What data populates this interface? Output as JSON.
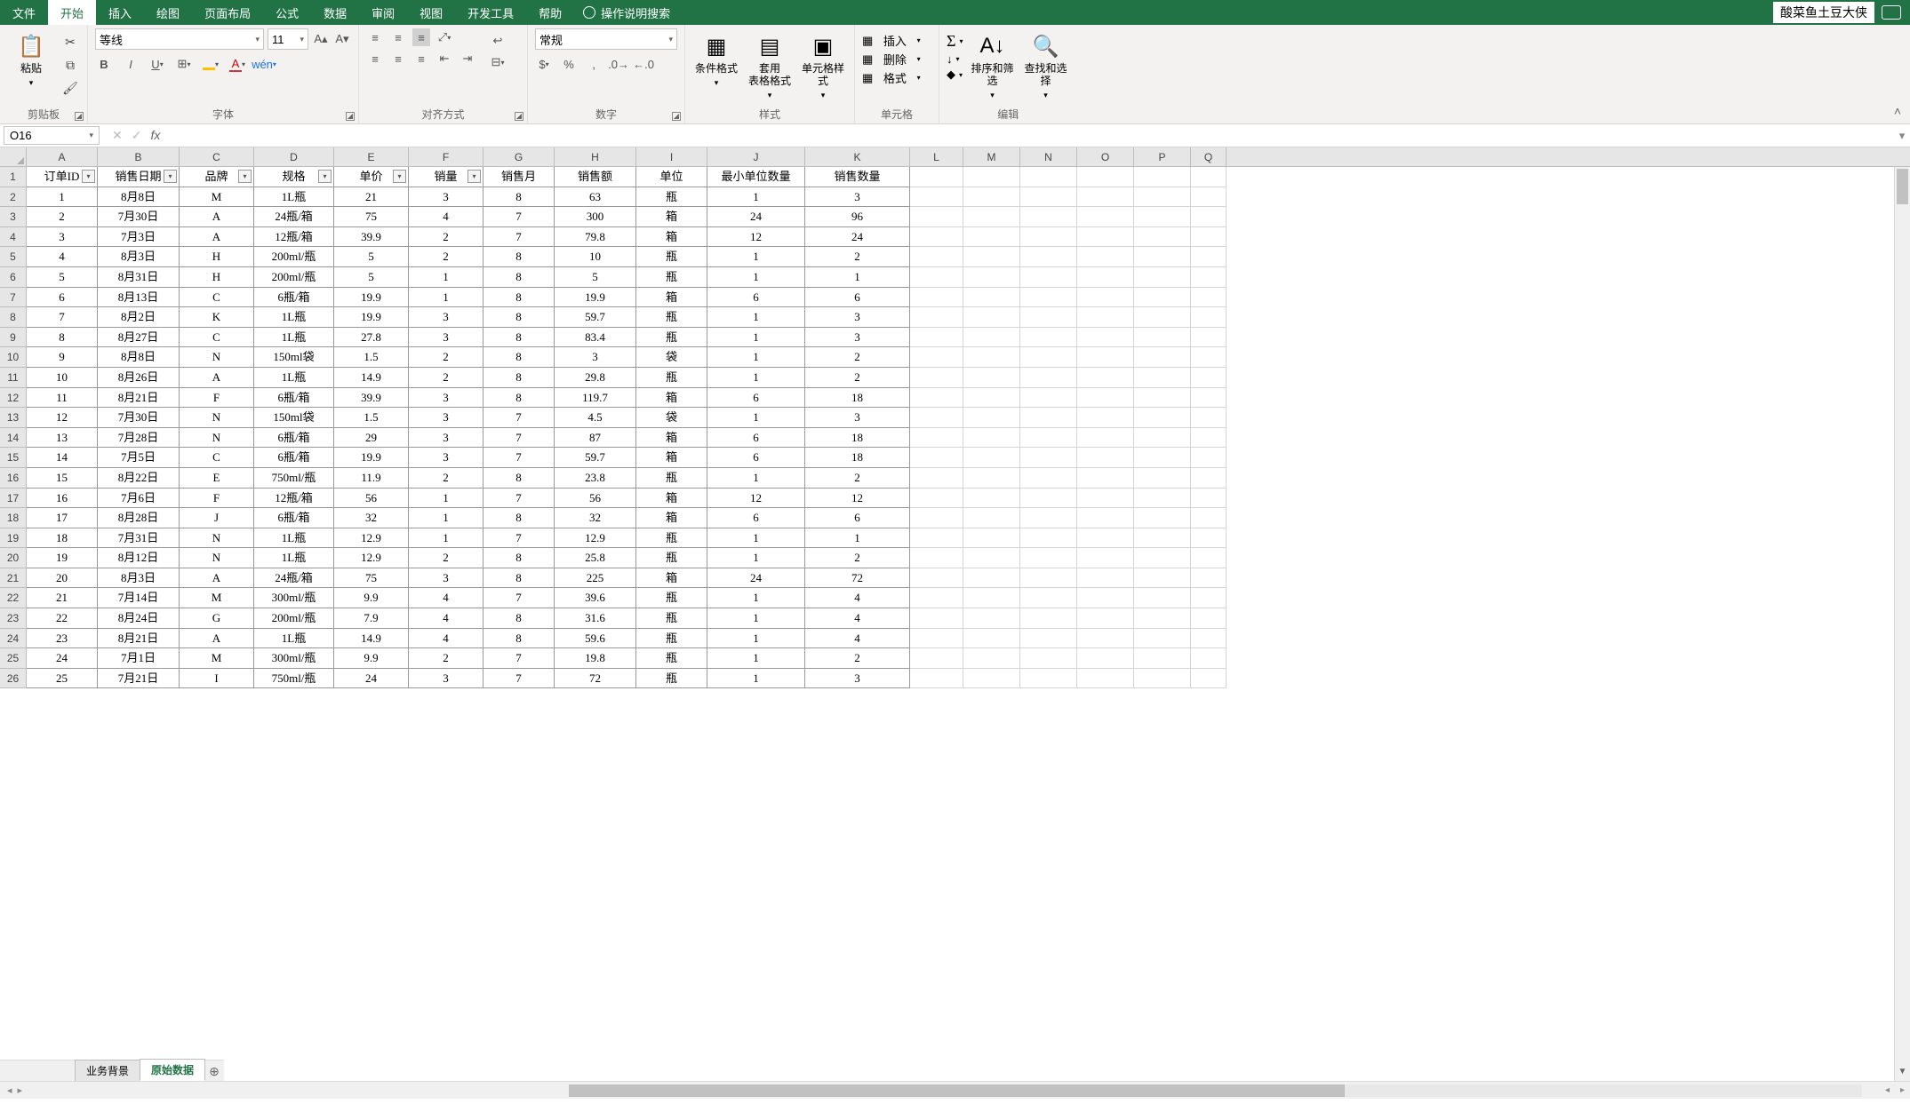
{
  "tabs": {
    "file": "文件",
    "home": "开始",
    "insert": "插入",
    "draw": "绘图",
    "layout": "页面布局",
    "formulas": "公式",
    "data": "数据",
    "review": "审阅",
    "view": "视图",
    "dev": "开发工具",
    "help": "帮助",
    "tellme": "操作说明搜索"
  },
  "user_name": "酸菜鱼土豆大侠",
  "ribbon": {
    "clipboard": {
      "paste": "粘贴",
      "label": "剪贴板"
    },
    "font": {
      "name": "等线",
      "size": "11",
      "label": "字体"
    },
    "align": {
      "label": "对齐方式"
    },
    "number": {
      "format": "常规",
      "label": "数字"
    },
    "styles": {
      "cond": "条件格式",
      "tbl": "套用\n表格格式",
      "cell": "单元格样式",
      "label": "样式"
    },
    "cells": {
      "insert": "插入",
      "delete": "删除",
      "format": "格式",
      "label": "单元格"
    },
    "editing": {
      "sort": "排序和筛选",
      "find": "查找和选择",
      "label": "编辑"
    }
  },
  "name_box": "O16",
  "columns": [
    "A",
    "B",
    "C",
    "D",
    "E",
    "F",
    "G",
    "H",
    "I",
    "J",
    "K",
    "L",
    "M",
    "N",
    "O",
    "P",
    "Q"
  ],
  "headers": [
    "订单ID",
    "销售日期",
    "品牌",
    "规格",
    "单价",
    "销量",
    "销售月",
    "销售额",
    "单位",
    "最小单位数量",
    "销售数量"
  ],
  "filters_on": [
    0,
    1,
    2,
    3,
    4,
    5
  ],
  "rows": [
    [
      "1",
      "8月8日",
      "M",
      "1L瓶",
      "21",
      "3",
      "8",
      "63",
      "瓶",
      "1",
      "3"
    ],
    [
      "2",
      "7月30日",
      "A",
      "24瓶/箱",
      "75",
      "4",
      "7",
      "300",
      "箱",
      "24",
      "96"
    ],
    [
      "3",
      "7月3日",
      "A",
      "12瓶/箱",
      "39.9",
      "2",
      "7",
      "79.8",
      "箱",
      "12",
      "24"
    ],
    [
      "4",
      "8月3日",
      "H",
      "200ml/瓶",
      "5",
      "2",
      "8",
      "10",
      "瓶",
      "1",
      "2"
    ],
    [
      "5",
      "8月31日",
      "H",
      "200ml/瓶",
      "5",
      "1",
      "8",
      "5",
      "瓶",
      "1",
      "1"
    ],
    [
      "6",
      "8月13日",
      "C",
      "6瓶/箱",
      "19.9",
      "1",
      "8",
      "19.9",
      "箱",
      "6",
      "6"
    ],
    [
      "7",
      "8月2日",
      "K",
      "1L瓶",
      "19.9",
      "3",
      "8",
      "59.7",
      "瓶",
      "1",
      "3"
    ],
    [
      "8",
      "8月27日",
      "C",
      "1L瓶",
      "27.8",
      "3",
      "8",
      "83.4",
      "瓶",
      "1",
      "3"
    ],
    [
      "9",
      "8月8日",
      "N",
      "150ml袋",
      "1.5",
      "2",
      "8",
      "3",
      "袋",
      "1",
      "2"
    ],
    [
      "10",
      "8月26日",
      "A",
      "1L瓶",
      "14.9",
      "2",
      "8",
      "29.8",
      "瓶",
      "1",
      "2"
    ],
    [
      "11",
      "8月21日",
      "F",
      "6瓶/箱",
      "39.9",
      "3",
      "8",
      "119.7",
      "箱",
      "6",
      "18"
    ],
    [
      "12",
      "7月30日",
      "N",
      "150ml袋",
      "1.5",
      "3",
      "7",
      "4.5",
      "袋",
      "1",
      "3"
    ],
    [
      "13",
      "7月28日",
      "N",
      "6瓶/箱",
      "29",
      "3",
      "7",
      "87",
      "箱",
      "6",
      "18"
    ],
    [
      "14",
      "7月5日",
      "C",
      "6瓶/箱",
      "19.9",
      "3",
      "7",
      "59.7",
      "箱",
      "6",
      "18"
    ],
    [
      "15",
      "8月22日",
      "E",
      "750ml/瓶",
      "11.9",
      "2",
      "8",
      "23.8",
      "瓶",
      "1",
      "2"
    ],
    [
      "16",
      "7月6日",
      "F",
      "12瓶/箱",
      "56",
      "1",
      "7",
      "56",
      "箱",
      "12",
      "12"
    ],
    [
      "17",
      "8月28日",
      "J",
      "6瓶/箱",
      "32",
      "1",
      "8",
      "32",
      "箱",
      "6",
      "6"
    ],
    [
      "18",
      "7月31日",
      "N",
      "1L瓶",
      "12.9",
      "1",
      "7",
      "12.9",
      "瓶",
      "1",
      "1"
    ],
    [
      "19",
      "8月12日",
      "N",
      "1L瓶",
      "12.9",
      "2",
      "8",
      "25.8",
      "瓶",
      "1",
      "2"
    ],
    [
      "20",
      "8月3日",
      "A",
      "24瓶/箱",
      "75",
      "3",
      "8",
      "225",
      "箱",
      "24",
      "72"
    ],
    [
      "21",
      "7月14日",
      "M",
      "300ml/瓶",
      "9.9",
      "4",
      "7",
      "39.6",
      "瓶",
      "1",
      "4"
    ],
    [
      "22",
      "8月24日",
      "G",
      "200ml/瓶",
      "7.9",
      "4",
      "8",
      "31.6",
      "瓶",
      "1",
      "4"
    ],
    [
      "23",
      "8月21日",
      "A",
      "1L瓶",
      "14.9",
      "4",
      "8",
      "59.6",
      "瓶",
      "1",
      "4"
    ],
    [
      "24",
      "7月1日",
      "M",
      "300ml/瓶",
      "9.9",
      "2",
      "7",
      "19.8",
      "瓶",
      "1",
      "2"
    ],
    [
      "25",
      "7月21日",
      "I",
      "750ml/瓶",
      "24",
      "3",
      "7",
      "72",
      "瓶",
      "1",
      "3"
    ]
  ],
  "sheets": {
    "s1": "业务背景",
    "s2": "原始数据"
  }
}
